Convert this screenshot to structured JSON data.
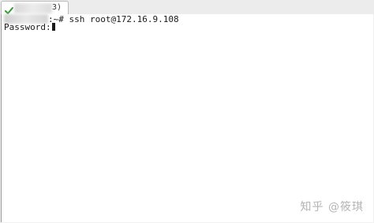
{
  "tab": {
    "icon": "green-check-icon",
    "title_suffix": "3)"
  },
  "terminal": {
    "line1_tail": ":~# ssh root@172.16.9.108",
    "line2": "Password:"
  },
  "watermark": {
    "text": "知乎 @筱琪"
  },
  "colors": {
    "check": "#2f9a2f",
    "text": "#1a1a1a",
    "watermark": "#b5b5b5"
  }
}
